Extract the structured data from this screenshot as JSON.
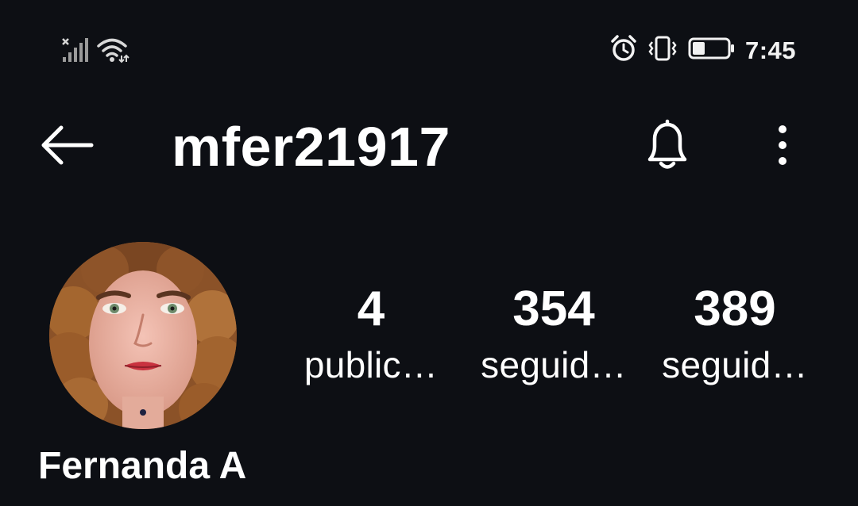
{
  "status_bar": {
    "time": "7:45",
    "icons": [
      "signal-no-service-icon",
      "wifi-icon",
      "alarm-icon",
      "vibrate-icon",
      "battery-icon"
    ],
    "battery_level": 0.35
  },
  "header": {
    "username": "mfer21917",
    "icons": [
      "back-arrow-icon",
      "bell-icon",
      "more-vertical-icon"
    ]
  },
  "profile": {
    "full_name": "Fernanda A",
    "stats": [
      {
        "value": "4",
        "label": "public…"
      },
      {
        "value": "354",
        "label": "seguid…"
      },
      {
        "value": "389",
        "label": "seguid…"
      }
    ]
  },
  "colors": {
    "background": "#0d0f14",
    "text": "#ffffff"
  }
}
